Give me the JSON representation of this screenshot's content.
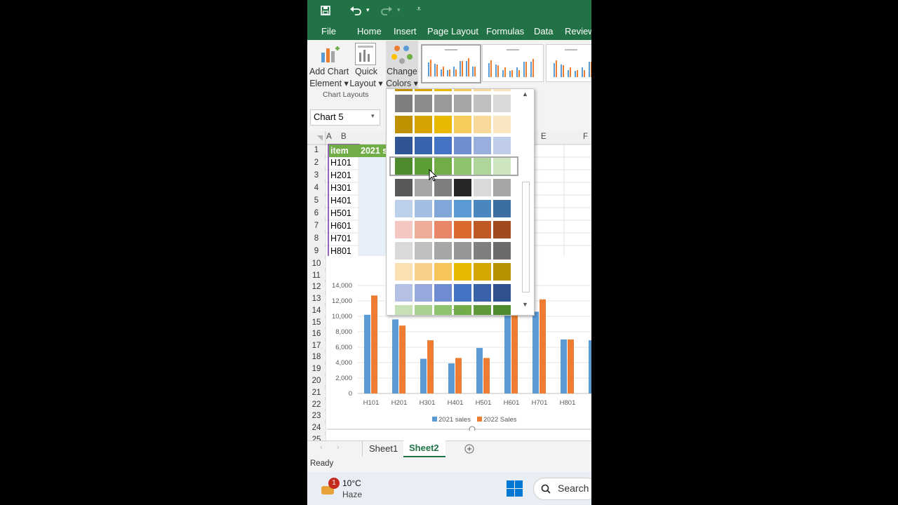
{
  "menu": [
    "File",
    "Home",
    "Insert",
    "Page Layout",
    "Formulas",
    "Data",
    "Review"
  ],
  "ribbon": {
    "add_chart_element": [
      "Add Chart",
      "Element ▾"
    ],
    "quick_layout": [
      "Quick",
      "Layout ▾"
    ],
    "change_colors": [
      "Change",
      "Colors ▾"
    ],
    "group_label": "Chart Layouts"
  },
  "namebox": "Chart 5",
  "columns": [
    "A",
    "B",
    "E",
    "F"
  ],
  "rows": [
    "1",
    "2",
    "3",
    "4",
    "5",
    "6",
    "7",
    "8",
    "9",
    "10",
    "11",
    "12",
    "13",
    "14",
    "15",
    "16",
    "17",
    "18",
    "19",
    "20",
    "21",
    "22",
    "23",
    "24",
    "25"
  ],
  "table": {
    "header": [
      "item",
      "2021 s"
    ],
    "items": [
      "H101",
      "H201",
      "H301",
      "H401",
      "H501",
      "H601",
      "H701",
      "H801"
    ]
  },
  "palette": {
    "rows": [
      [
        "#7f7f7f",
        "#8c8c8c",
        "#999999",
        "#a6a6a6",
        "#bfbfbf",
        "#d9d9d9"
      ],
      [
        "#bf9000",
        "#d6a300",
        "#e8b900",
        "#f5cb5c",
        "#f8d99a",
        "#fbe6c2"
      ],
      [
        "#2f5597",
        "#3764ad",
        "#4472c4",
        "#6d8fd2",
        "#98aedd",
        "#c0cde9"
      ],
      [
        "#4e8a2e",
        "#5b9f35",
        "#70ad47",
        "#8fc46f",
        "#aed69a",
        "#cde6c1"
      ],
      [
        "#595959",
        "#a5a5a5",
        "#7f7f7f",
        "#262626",
        "#d9d9d9",
        "#a6a6a6"
      ],
      [
        "#bdd0ea",
        "#a3bde3",
        "#7fa7d8",
        "#5b9bd5",
        "#4a86c0",
        "#3c6e9f"
      ],
      [
        "#f4c7c3",
        "#eeac96",
        "#e8866a",
        "#d9692e",
        "#bf5a25",
        "#a04b1f"
      ],
      [
        "#d9d9d9",
        "#bfbfbf",
        "#a6a6a6",
        "#969696",
        "#7f7f7f",
        "#6b6b6b"
      ],
      [
        "#fbe0b4",
        "#f9d089",
        "#f5c55a",
        "#e8b900",
        "#d4a700",
        "#b59000"
      ],
      [
        "#b4c0e4",
        "#97a9dc",
        "#6f8bd1",
        "#4472c4",
        "#3a62a9",
        "#2f5190"
      ],
      [
        "#c6e0b4",
        "#a9d08e",
        "#8fc46f",
        "#70ad47",
        "#5e9a3a",
        "#4e8a2e"
      ]
    ]
  },
  "chart_data": {
    "type": "bar",
    "categories": [
      "H101",
      "H201",
      "H301",
      "H401",
      "H501",
      "H601",
      "H701",
      "H801",
      "H"
    ],
    "series": [
      {
        "name": "2021 sales",
        "color": "#5b9bd5",
        "values": [
          10200,
          9600,
          4500,
          3900,
          5900,
          10500,
          10600,
          7000,
          6900
        ]
      },
      {
        "name": "2022 Sales",
        "color": "#ed7d31",
        "values": [
          12700,
          8800,
          6900,
          4600,
          4600,
          10300,
          12200,
          7000,
          0
        ]
      }
    ],
    "ylim": [
      0,
      14000
    ],
    "yticks": [
      "14,000",
      "12,000",
      "10,000",
      "8,000",
      "6,000",
      "4,000",
      "2,000",
      "0"
    ],
    "legend": "bottom"
  },
  "tabs": [
    "Sheet1",
    "Sheet2"
  ],
  "status": "Ready",
  "taskbar": {
    "badge": "1",
    "temp": "10°C",
    "weather": "Haze",
    "search": "Search"
  }
}
